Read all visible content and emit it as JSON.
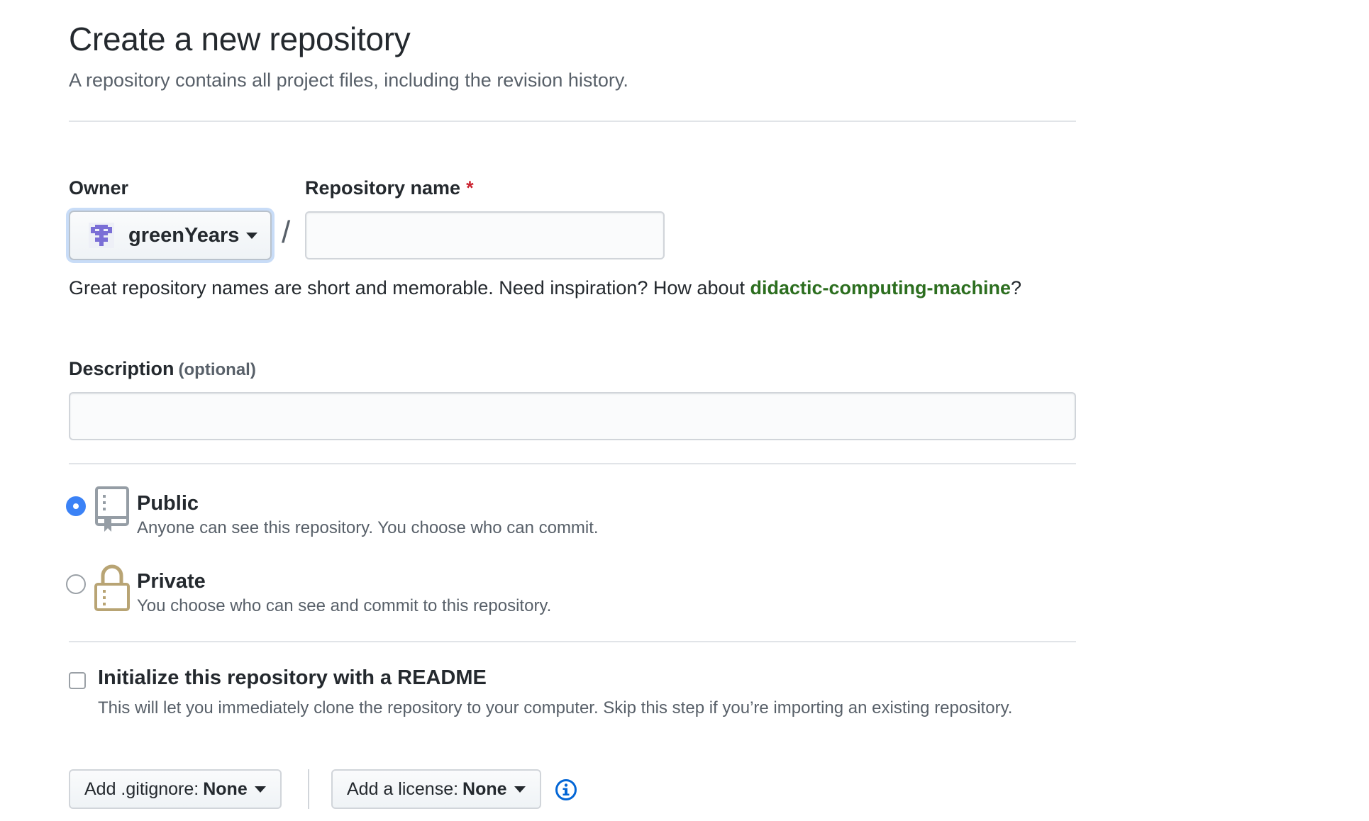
{
  "header": {
    "title": "Create a new repository",
    "subtitle": "A repository contains all project files, including the revision history."
  },
  "owner": {
    "label": "Owner",
    "selected": "greenYears"
  },
  "repo_name": {
    "label": "Repository name",
    "required_mark": "*",
    "value": "",
    "separator": "/"
  },
  "hint": {
    "text": "Great repository names are short and memorable. Need inspiration? How about ",
    "suggestion": "didactic-computing-machine",
    "end": "?"
  },
  "description": {
    "label": "Description",
    "optional": "(optional)",
    "value": ""
  },
  "visibility": {
    "selected": "public",
    "public": {
      "title": "Public",
      "desc": "Anyone can see this repository. You choose who can commit.",
      "icon": "repo-book-icon"
    },
    "private": {
      "title": "Private",
      "desc": "You choose who can see and commit to this repository.",
      "icon": "lock-icon"
    }
  },
  "init": {
    "checked": false,
    "title": "Initialize this repository with a README",
    "desc": "This will let you immediately clone the repository to your computer. Skip this step if you’re importing an existing repository."
  },
  "gitignore": {
    "label": "Add .gitignore:",
    "value": "None"
  },
  "license": {
    "label": "Add a license:",
    "value": "None"
  },
  "colors": {
    "accent": "#3b82f6",
    "suggestion": "#2c6e1f",
    "required": "#cb2431",
    "lock": "#b8a474"
  }
}
